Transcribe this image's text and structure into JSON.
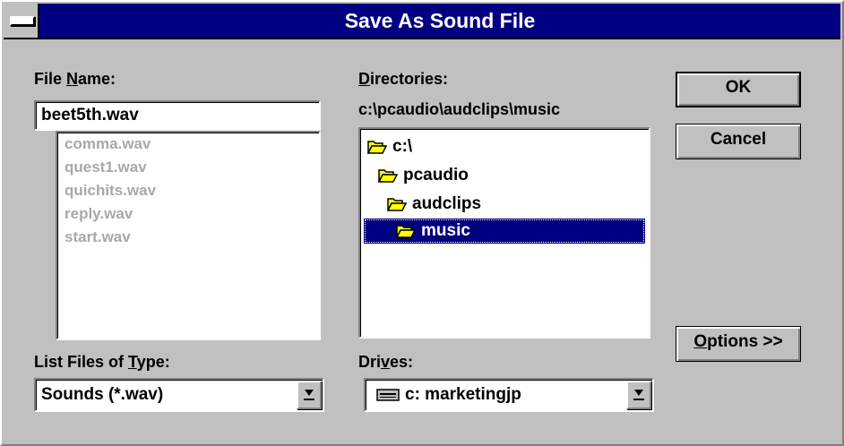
{
  "window": {
    "title": "Save As Sound File"
  },
  "file_name": {
    "label_pre": "File ",
    "label_accel": "N",
    "label_post": "ame:",
    "value": "beet5th.wav",
    "files": [
      "comma.wav",
      "quest1.wav",
      "quichits.wav",
      "reply.wav",
      "start.wav"
    ]
  },
  "directories": {
    "label_accel": "D",
    "label_post": "irectories:",
    "current_path": "c:\\pcaudio\\audclips\\music",
    "items": [
      "c:\\",
      "pcaudio",
      "audclips",
      "music"
    ],
    "selected": "music"
  },
  "file_type": {
    "label_pre": "List Files of ",
    "label_accel": "T",
    "label_post": "ype:",
    "value": "Sounds (*.wav)"
  },
  "drives": {
    "label_pre": "Dri",
    "label_accel": "v",
    "label_post": "es:",
    "value": "c: marketingjp"
  },
  "buttons": {
    "ok": "OK",
    "cancel": "Cancel",
    "options_accel": "O",
    "options_post": "ptions >>"
  },
  "colors": {
    "face": "#c0c0c0",
    "titlebar": "#000080",
    "selection": "#000080",
    "disabled_text": "#a8a8a8",
    "folder": "#ffff00"
  },
  "icons": [
    "system-menu-icon",
    "folder-open-icon",
    "drive-icon",
    "dropdown-arrow-icon"
  ]
}
